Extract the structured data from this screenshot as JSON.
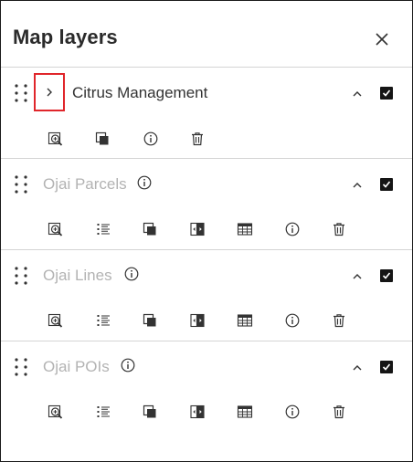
{
  "panel": {
    "title": "Map layers",
    "close_icon": "close-icon"
  },
  "layers": [
    {
      "name": "Citrus Management",
      "state": "active",
      "expand_icon": "chevron-right-icon",
      "visible": true,
      "tools": [
        "zoom-to-icon",
        "duplicate-icon",
        "info-icon",
        "delete-icon"
      ]
    },
    {
      "name": "Ojai Parcels",
      "state": "dimmed",
      "visible": true,
      "tools": [
        "zoom-to-icon",
        "legend-list-icon",
        "duplicate-icon",
        "swipe-compare-icon",
        "attribute-table-icon",
        "info-icon",
        "delete-icon"
      ]
    },
    {
      "name": "Ojai Lines",
      "state": "dimmed",
      "visible": true,
      "tools": [
        "zoom-to-icon",
        "legend-list-icon",
        "duplicate-icon",
        "swipe-compare-icon",
        "attribute-table-icon",
        "info-icon",
        "delete-icon"
      ]
    },
    {
      "name": "Ojai POIs",
      "state": "dimmed",
      "visible": true,
      "tools": [
        "zoom-to-icon",
        "legend-list-icon",
        "duplicate-icon",
        "swipe-compare-icon",
        "attribute-table-icon",
        "info-icon",
        "delete-icon"
      ]
    }
  ],
  "colors": {
    "highlight_border": "#e0262b",
    "dimmed_text": "#b3b3b3",
    "checkbox_fill": "#151515"
  }
}
